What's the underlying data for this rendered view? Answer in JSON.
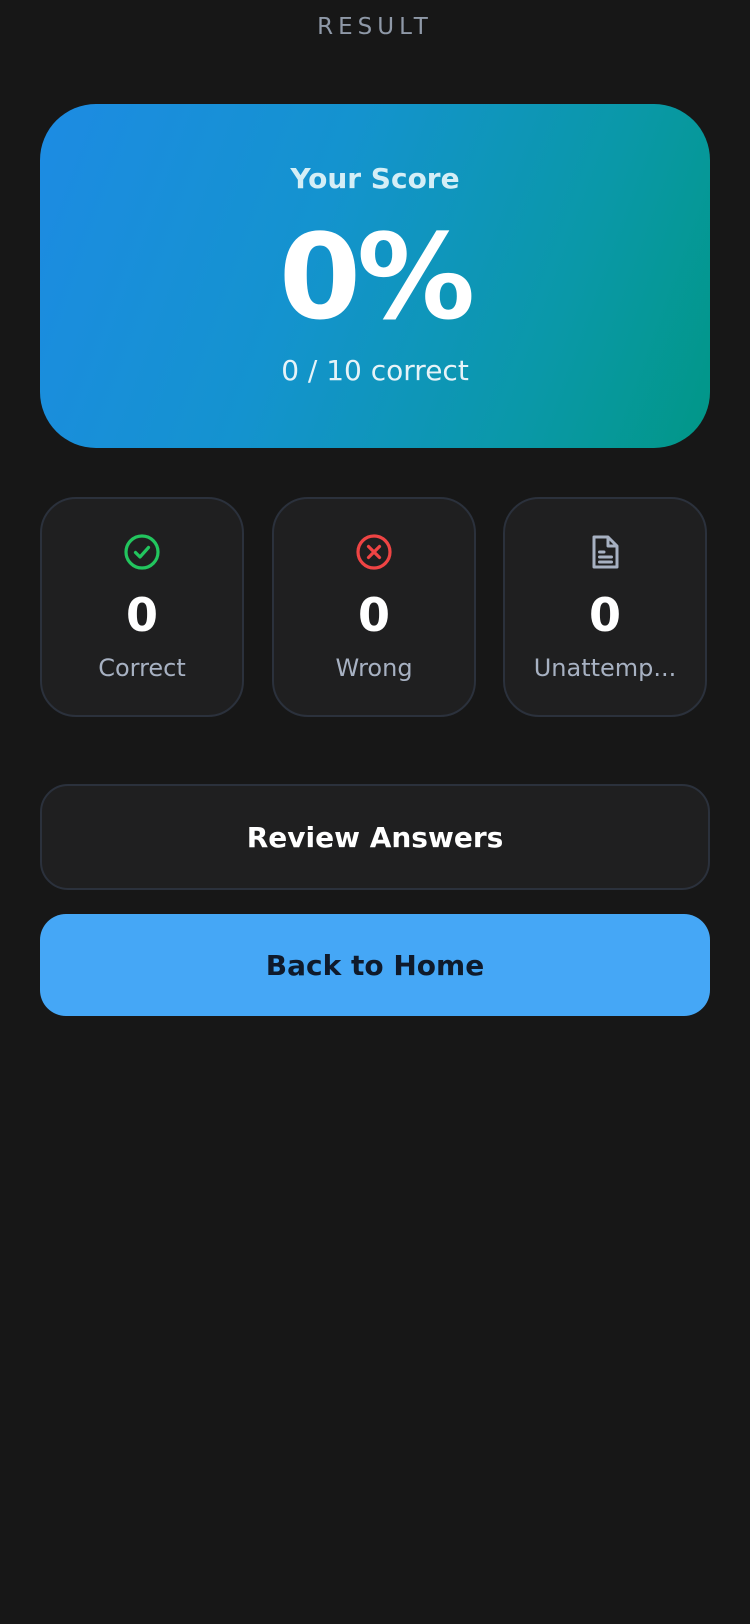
{
  "header": {
    "title": "RESULT"
  },
  "score_card": {
    "label": "Your Score",
    "percent": "0%",
    "fraction": "0 / 10 correct",
    "gradient_start": "#1d8be3",
    "gradient_end": "#019787"
  },
  "stats": [
    {
      "icon": "check-circle-icon",
      "value": "0",
      "label": "Correct",
      "color": "#22c55e"
    },
    {
      "icon": "x-circle-icon",
      "value": "0",
      "label": "Wrong",
      "color": "#ef4444"
    },
    {
      "icon": "document-icon",
      "value": "0",
      "label": "Unattemp...",
      "color": "#a7b1c2"
    }
  ],
  "actions": {
    "review_label": "Review Answers",
    "home_label": "Back to Home",
    "home_color": "#45a7f6"
  }
}
